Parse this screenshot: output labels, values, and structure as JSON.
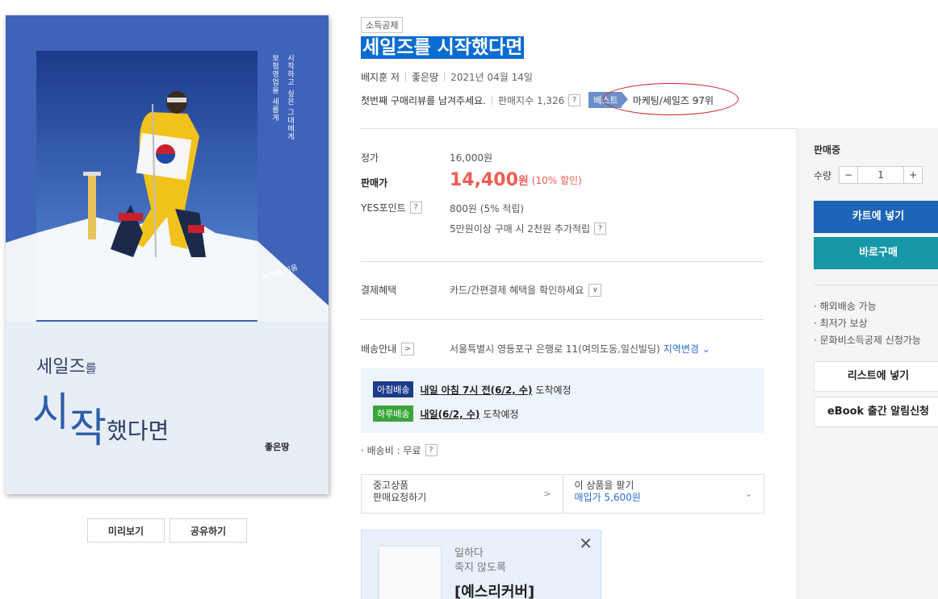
{
  "cover": {
    "vertical_line1": "보험영업을 새롭게",
    "vertical_line2": "시작하고 싶은 그대에게",
    "author_name": "배지훈",
    "author_suffix": "지음",
    "title_line1_main": "세일즈",
    "title_line1_particle": "를",
    "title_line2_char1": "시",
    "title_line2_char2": "작",
    "title_line2_rest": "했다면",
    "publisher_logo": "좋은땅"
  },
  "cover_buttons": {
    "preview": "미리보기",
    "share": "공유하기"
  },
  "product": {
    "tag": "소득공제",
    "title": "세일즈를 시작했다면",
    "author": "배지훈 저",
    "publisher": "좋은땅",
    "date": "2021년 04월 14일",
    "review_prompt": "첫번째 구매리뷰를 남겨주세요.",
    "sales_index": "판매지수 1,326",
    "best_label": "베스트",
    "best_rank": "마케팅/세일즈 97위"
  },
  "pricing": {
    "list_price_label": "정가",
    "list_price": "16,000원",
    "sale_price_label": "판매가",
    "sale_price": "14,400",
    "sale_price_unit": "원",
    "discount": "(10% 할인)",
    "points_label": "YES포인트",
    "points": "800원 (5% 적립)",
    "points_extra": "5만원이상 구매 시 2천원 추가적립"
  },
  "payment": {
    "label": "결제혜택",
    "text": "카드/간편결제 혜택을 확인하세요"
  },
  "shipping": {
    "label": "배송안내",
    "address": "서울특별시 영등포구 은행로 11(여의도동,일신빌딩)",
    "change": "지역변경",
    "morning_badge": "아침배송",
    "morning_time": "내일 아침 7시 전(6/2, 수)",
    "morning_suffix": "도착예정",
    "day_badge": "하루배송",
    "day_time": "내일(6/2, 수)",
    "day_suffix": "도착예정",
    "fee": "배송비 : 무료"
  },
  "used": {
    "left_line1": "중고상품",
    "left_line2": "판매요청하기",
    "right_line1": "이 상품을 팔기",
    "right_line2": "매입가 5,600원"
  },
  "promo": {
    "line1": "일하다",
    "line2": "죽지 않도록",
    "line3": "[예스리커버]"
  },
  "sidebar": {
    "status": "판매중",
    "qty_label": "수량",
    "qty_minus": "−",
    "qty_value": "1",
    "qty_plus": "+",
    "cart": "카트에 넣기",
    "buy": "바로구매",
    "info": [
      "· 해외배송 가능",
      "· 최저가 보상",
      "· 문화비소득공제 신청가능"
    ],
    "wishlist": "리스트에 넣기",
    "ebook": "eBook 출간 알림신청"
  }
}
